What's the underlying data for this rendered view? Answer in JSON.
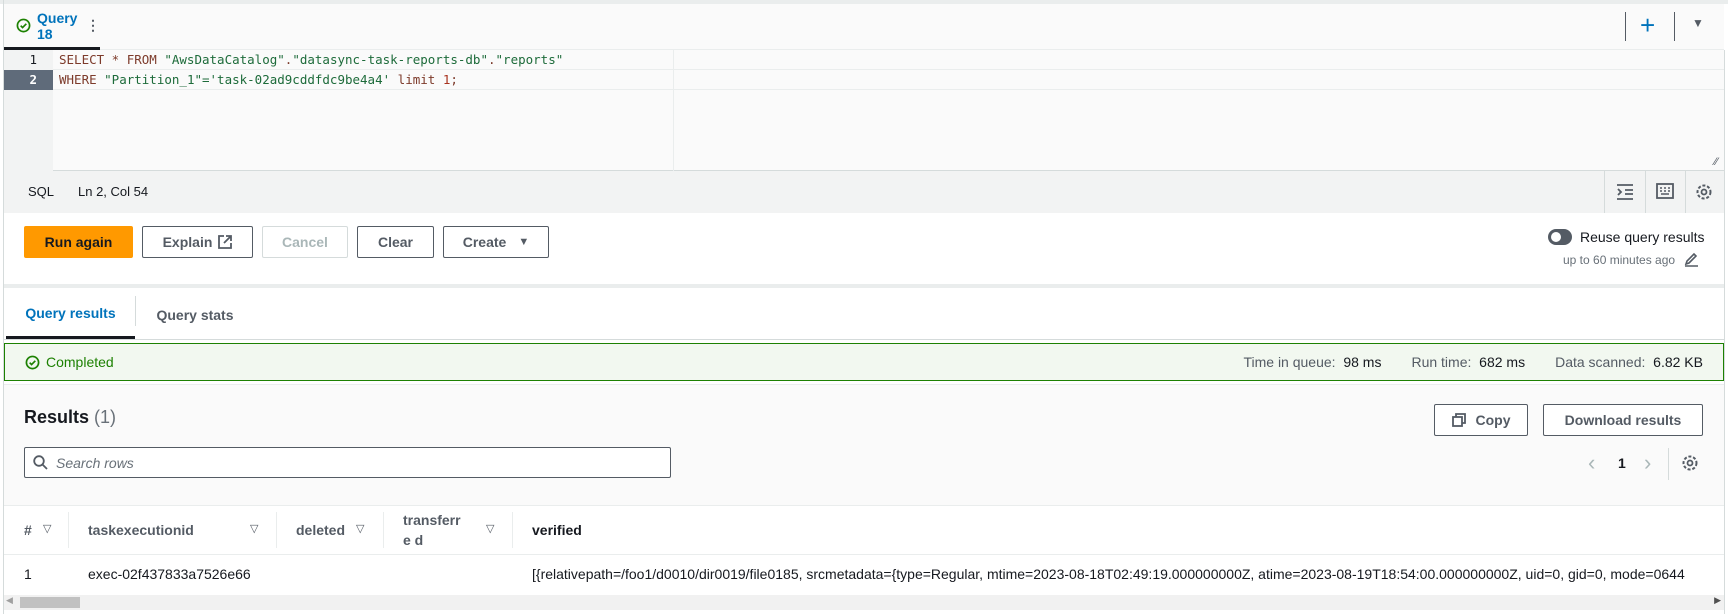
{
  "tab": {
    "title": "Query 18",
    "status": "completed"
  },
  "editor": {
    "lines": [
      {
        "n": "1",
        "parts": [
          [
            "kw",
            "SELECT * FROM "
          ],
          [
            "str",
            "\"AwsDataCatalog\""
          ],
          [
            "kw",
            "."
          ],
          [
            "str",
            "\"datasync-task-reports-db\""
          ],
          [
            "kw",
            "."
          ],
          [
            "str",
            "\"reports\""
          ]
        ]
      },
      {
        "n": "2",
        "parts": [
          [
            "kw",
            "WHERE "
          ],
          [
            "str",
            "\"Partition_1\"='task-02ad9cddfdc9be4a4'"
          ],
          [
            "kw",
            " limit "
          ],
          [
            "num",
            "1"
          ],
          [
            "kw",
            ";"
          ]
        ]
      }
    ]
  },
  "statusbar": {
    "lang": "SQL",
    "position": "Ln 2, Col 54"
  },
  "toolbar": {
    "run": "Run again",
    "explain": "Explain",
    "cancel": "Cancel",
    "clear": "Clear",
    "create": "Create"
  },
  "reuse": {
    "label": "Reuse query results",
    "sub": "up to 60 minutes ago",
    "enabled": false
  },
  "tabs": {
    "results": "Query results",
    "stats": "Query stats"
  },
  "status": {
    "text": "Completed",
    "queue_label": "Time in queue:",
    "queue": "98 ms",
    "run_label": "Run time:",
    "run": "682 ms",
    "scan_label": "Data scanned:",
    "scan": "6.82 KB"
  },
  "results": {
    "title": "Results",
    "count": "(1)",
    "copy": "Copy",
    "download": "Download results",
    "search_placeholder": "Search rows",
    "page": "1",
    "columns": [
      "#",
      "taskexecutionid",
      "deleted",
      "transferre d",
      "verified"
    ],
    "rows": [
      [
        "1",
        "exec-02f437833a7526e66",
        "",
        "",
        "[{relativepath=/foo1/d0010/dir0019/file0185, srcmetadata={type=Regular, mtime=2023-08-18T02:49:19.000000000Z, atime=2023-08-19T18:54:00.000000000Z, uid=0, gid=0, mode=0644"
      ]
    ]
  }
}
